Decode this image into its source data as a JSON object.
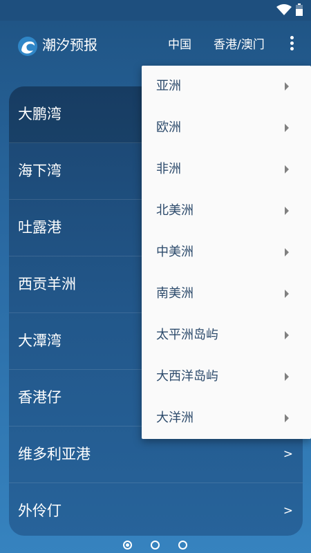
{
  "status_bar": {
    "icons": [
      "wifi-icon",
      "battery-icon"
    ]
  },
  "app_bar": {
    "logo_icon": "wave-logo-icon",
    "title": "潮汐预报",
    "tabs": [
      {
        "label": "中国"
      },
      {
        "label": "香港/澳门"
      }
    ],
    "more_icon": "more-vert-icon"
  },
  "location_list": {
    "items": [
      {
        "label": "大鹏湾",
        "chevron": ">"
      },
      {
        "label": "海下湾",
        "chevron": ">"
      },
      {
        "label": "吐露港",
        "chevron": ">"
      },
      {
        "label": "西贡羊洲",
        "chevron": ">"
      },
      {
        "label": "大潭湾",
        "chevron": ">"
      },
      {
        "label": "香港仔",
        "chevron": ">"
      },
      {
        "label": "维多利亚港",
        "chevron": ">"
      },
      {
        "label": "外伶仃",
        "chevron": ">"
      }
    ]
  },
  "dropdown_menu": {
    "items": [
      {
        "label": "亚洲"
      },
      {
        "label": "欧洲"
      },
      {
        "label": "非洲"
      },
      {
        "label": "北美洲"
      },
      {
        "label": "中美洲"
      },
      {
        "label": "南美洲"
      },
      {
        "label": "太平洲岛屿"
      },
      {
        "label": "大西洋岛屿"
      },
      {
        "label": "大洋洲"
      }
    ],
    "submenu_icon": "submenu-arrow-icon"
  },
  "pager": {
    "count": 3,
    "active_index": 0
  },
  "colors": {
    "background": "#2a6aa3",
    "status_bar": "#1e4f7e",
    "card": "#22578a",
    "menu_background": "#fafafa",
    "menu_text": "#2c4a6b"
  }
}
